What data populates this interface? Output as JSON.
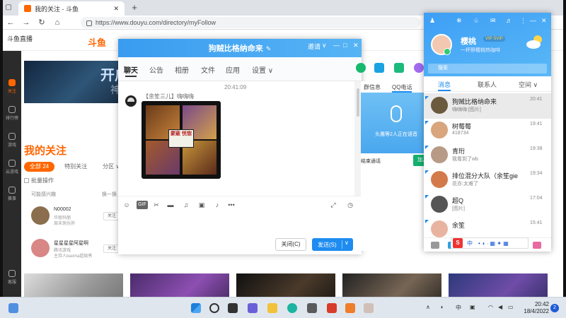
{
  "browser": {
    "tab_title": "我的关注 - 斗鱼",
    "tab_close": "✕",
    "new_tab": "+",
    "url": "https://www.douyu.com/directory/myFollow"
  },
  "douyu": {
    "top_left_logo": "斗鱼直播",
    "logo": "斗鱼",
    "sidebar": [
      {
        "label": "关注"
      },
      {
        "label": "排行榜"
      },
      {
        "label": "游戏"
      },
      {
        "label": "云游戏"
      },
      {
        "label": "赛事"
      },
      {
        "label": "客服"
      }
    ],
    "banner_text": "开启",
    "banner_sub": "神",
    "follow_title": "我的关注",
    "filters": [
      {
        "label": "全部 24",
        "active": true
      },
      {
        "label": "特别关注",
        "active": false
      },
      {
        "label": "分区 ∨",
        "active": false
      }
    ],
    "batch_label": "批量操作",
    "possible_label": "可能感兴趣",
    "swap_label": "换一换",
    "persons": [
      {
        "name": "N00002",
        "desc1": "华丽玛丽",
        "desc2": "周末快乐肝",
        "follow": "关注",
        "color": "#8a6e4d"
      },
      {
        "name": "星星星星阿星啊",
        "desc1": "腾讯游戏",
        "desc2": "主持人baoma超级秀",
        "follow": "关注",
        "color": "#d98686"
      }
    ]
  },
  "chat": {
    "title": "狗贼比格纳命来",
    "title_edit": "✎",
    "head_controls": [
      "邀请",
      "∨",
      "—",
      "□",
      "✕"
    ],
    "tabs": [
      "聊天",
      "公告",
      "相册",
      "文件",
      "应用",
      "设置 ∨"
    ],
    "time": "20:41:09",
    "sender": "【余笙三儿】嗨嗨嗨",
    "meme_caption": "蒙蔽 恍惚",
    "close_label": "关闭(C)",
    "send_label": "发送(S)",
    "send_dropdown": "∨",
    "right_tabs": [
      "群信息",
      "QQ电话"
    ],
    "call_text": "头鹰等2人正在语音",
    "end_call": "结束通话",
    "join_label": "加入"
  },
  "qq": {
    "top_icons": [
      "❄",
      "♧",
      "✉",
      "♬",
      "⋮",
      "—",
      "✕"
    ],
    "name": "樱桃",
    "badge": "VIP SVIP",
    "signature": "一杯野樱桃热咖啡",
    "search_placeholder": "搜索",
    "tabs": [
      "消息",
      "联系人",
      "空间 ∨"
    ],
    "conversations": [
      {
        "title": "狗贼比格纳命来",
        "preview": "嗨嗨嗨:[图片]",
        "time": "20:41",
        "color": "#6b5a3e",
        "selected": true
      },
      {
        "title": "树莓莓",
        "preview": "418734",
        "time": "19:41",
        "color": "#d9a57c",
        "selected": false
      },
      {
        "title": "青珩",
        "preview": "我看到了wb",
        "time": "19:38",
        "color": "#b79b86",
        "selected": false
      },
      {
        "title": "排位混分大队（余笙gie",
        "preview": "花亦:太难了",
        "time": "19:34",
        "color": "#d27a4a",
        "selected": false
      },
      {
        "title": "超Q",
        "preview": "[图片]",
        "time": "17:04",
        "color": "#555555",
        "selected": false
      },
      {
        "title": "余笙",
        "preview": "",
        "time": "15:41",
        "color": "#e8b4a0",
        "selected": false
      }
    ],
    "ime_label": "中"
  },
  "taskbar": {
    "time": "20:42",
    "date": "18/4/2022",
    "notif_count": "2",
    "lang": "中",
    "tray_up": "∧"
  }
}
